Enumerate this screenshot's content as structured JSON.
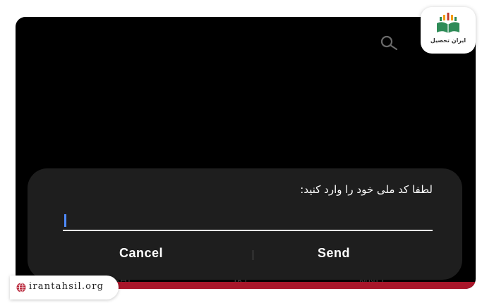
{
  "dialog": {
    "prompt": "لطفا کد ملی خود را وارد کنید:",
    "input_value": "",
    "cancel_label": "Cancel",
    "send_label": "Send"
  },
  "background_keypad": {
    "key_1": "GHI",
    "key_2": "JKL",
    "key_3": "MNO"
  },
  "watermark": {
    "brand_name": "ایران تحصیل",
    "url": "irantahsil.org"
  },
  "icons": {
    "search": "search-icon",
    "globe": "globe-icon",
    "logo": "book-logo-icon"
  },
  "colors": {
    "screen_bg": "#000000",
    "dialog_bg": "#1e1e1e",
    "caret": "#4f8bff",
    "accent_strip": "#a8162a",
    "logo_green": "#2e8b57",
    "logo_orange": "#f39c12",
    "logo_red": "#c0392b"
  }
}
